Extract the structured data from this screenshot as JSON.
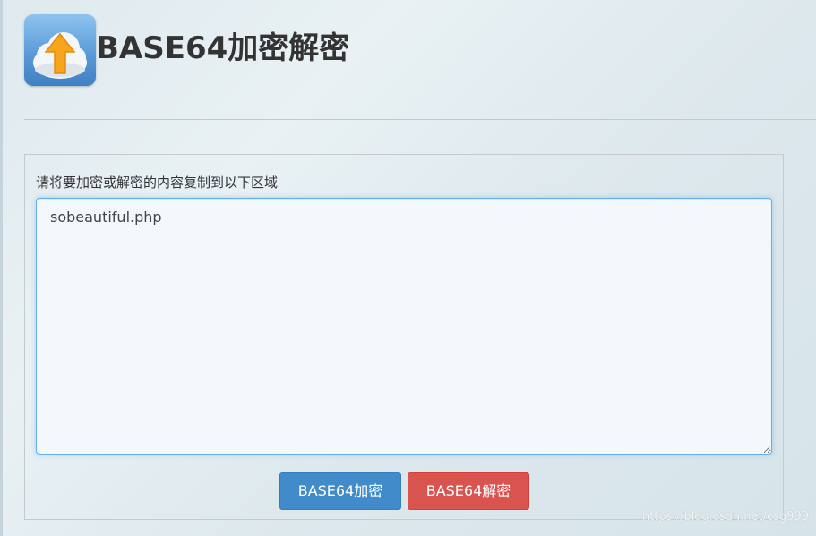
{
  "header": {
    "title": "BASE64加密解密",
    "icon": "cloud-upload-icon"
  },
  "panel": {
    "label": "请将要加密或解密的内容复制到以下区域",
    "textarea_value": "sobeautiful.php"
  },
  "buttons": {
    "encode_label": "BASE64加密",
    "decode_label": "BASE64解密"
  },
  "watermark": "https://blog.csdn.net/csg999",
  "colors": {
    "encode_button": "#428bca",
    "decode_button": "#d9534f",
    "focus_border": "#66afe9"
  }
}
